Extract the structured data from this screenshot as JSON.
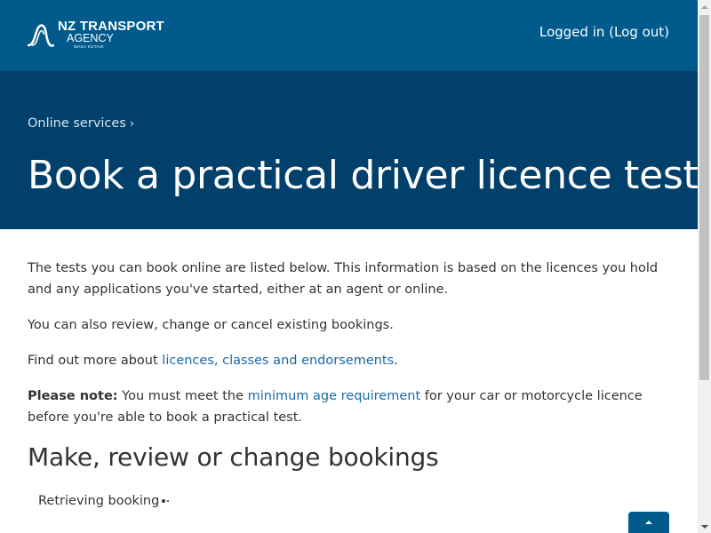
{
  "header": {
    "logo": {
      "icon": "nzta-swoosh-logo-icon",
      "line1": "NZ TRANSPORT",
      "line2": "AGENCY",
      "line3": "WAKA KOTAHI"
    },
    "user_status": "Logged in",
    "logout_label": "(Log out)"
  },
  "hero": {
    "breadcrumb": {
      "link": "Online services",
      "separator": "›"
    },
    "title": "Book a practical driver licence test"
  },
  "content": {
    "para1": "The tests you can book online are listed below. This information is based on the licences you hold and any applications you've started, either at an agent or online.",
    "para2": "You can also review, change or cancel existing bookings.",
    "para3": {
      "before": "Find out more about ",
      "link": "licences, classes and endorsements",
      "after": "."
    },
    "para4": {
      "bold": "Please note:",
      "before": " You must meet the ",
      "link": "minimum age requirement",
      "after": " for your car or motorcycle licence before you're able to book a practical test."
    },
    "section_title": "Make, review or change bookings",
    "loading_text": "Retrieving booking"
  },
  "back_to_top": {
    "icon": "caret-up-icon"
  },
  "colors": {
    "header_bg": "#005a8c",
    "hero_bg": "#00406b",
    "link": "#1a6aa8",
    "text": "#333333"
  }
}
